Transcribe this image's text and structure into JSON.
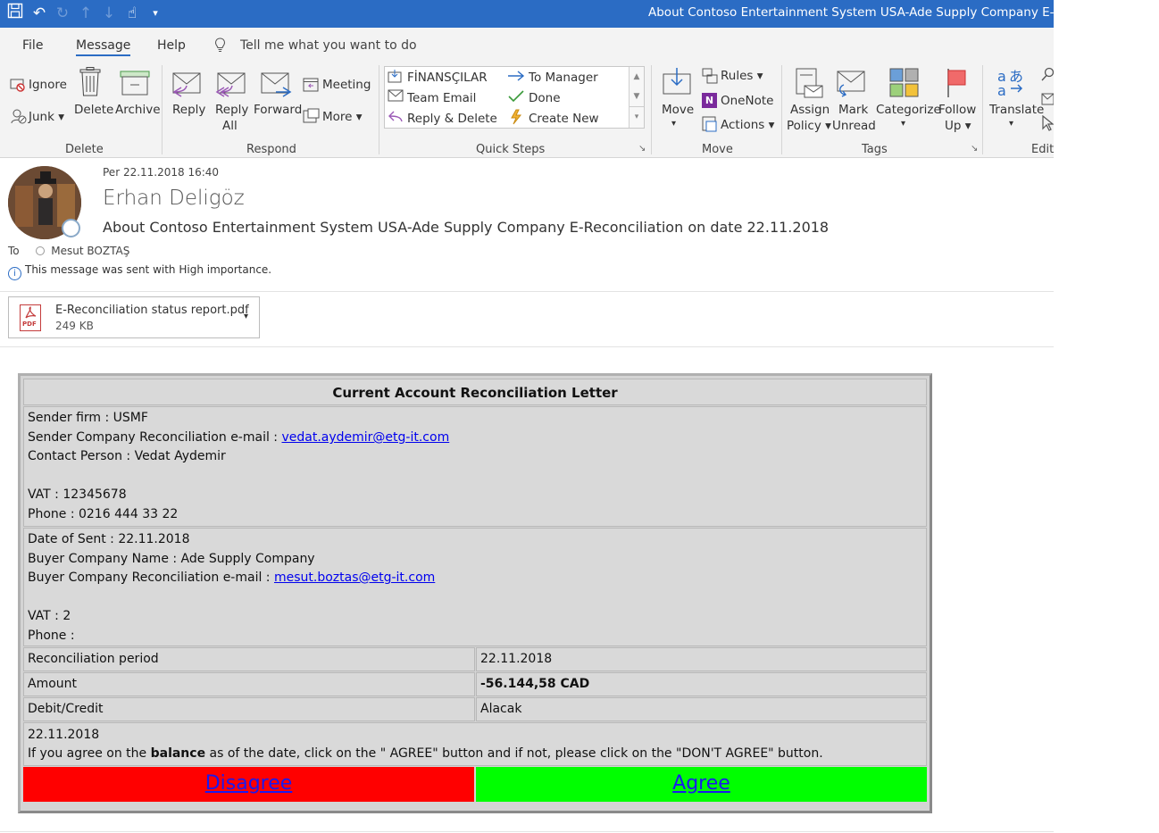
{
  "titlebar": {
    "title": "About Contoso Entertainment System USA-Ade Supply Company E-Reconci"
  },
  "menu": {
    "file": "File",
    "message": "Message",
    "help": "Help",
    "tell_me": "Tell me what you want to do"
  },
  "ribbon": {
    "delete_group": {
      "ignore": "Ignore",
      "junk": "Junk",
      "delete": "Delete",
      "archive": "Archive",
      "label": "Delete"
    },
    "respond_group": {
      "reply": "Reply",
      "reply_all_1": "Reply",
      "reply_all_2": "All",
      "forward": "Forward",
      "meeting": "Meeting",
      "more": "More",
      "label": "Respond"
    },
    "quick_steps": {
      "items": [
        "FİNANSÇILAR",
        "Team Email",
        "Reply & Delete",
        "To Manager",
        "Done",
        "Create New"
      ],
      "label": "Quick Steps"
    },
    "move_group": {
      "move": "Move",
      "rules": "Rules",
      "onenote": "OneNote",
      "actions": "Actions",
      "label": "Move"
    },
    "tags_group": {
      "assign_1": "Assign",
      "assign_2": "Policy",
      "mark_1": "Mark",
      "mark_2": "Unread",
      "categorize": "Categorize",
      "follow_1": "Follow",
      "follow_2": "Up",
      "label": "Tags"
    },
    "edit_group": {
      "translate": "Translate",
      "label": "Edit"
    }
  },
  "header": {
    "date": "Per 22.11.2018 16:40",
    "sender": "Erhan Deligöz",
    "subject": "About Contoso Entertainment System USA-Ade Supply Company E-Reconciliation on date 22.11.2018",
    "to_label": "To",
    "to_name": "Mesut BOZTAŞ",
    "importance": "This message was sent with High importance."
  },
  "attachment": {
    "name": "E-Reconciliation status report.pdf",
    "size": "249 KB",
    "icon_text": "PDF"
  },
  "letter": {
    "title": "Current Account Reconciliation Letter",
    "sender_firm": "Sender firm : USMF",
    "sender_email_label": "Sender Company Reconciliation e-mail : ",
    "sender_email": "vedat.aydemir@etg-it.com",
    "contact": "Contact Person : Vedat Aydemir",
    "sender_vat": "VAT : 12345678",
    "sender_phone": "Phone : 0216 444 33 22",
    "date_sent": "Date of Sent : 22.11.2018",
    "buyer_name": "Buyer Company Name : Ade Supply Company",
    "buyer_email_label": "Buyer Company Reconciliation e-mail : ",
    "buyer_email": "mesut.boztas@etg-it.com",
    "buyer_vat": "VAT : 2",
    "buyer_phone": "Phone :",
    "rows": [
      {
        "label": "Reconciliation period",
        "value": "22.11.2018"
      },
      {
        "label": "Amount",
        "value": "-56.144,58 CAD"
      },
      {
        "label": "Debit/Credit",
        "value": "Alacak"
      }
    ],
    "note_date": "22.11.2018",
    "note_1": "If you agree on the ",
    "note_bold": "balance",
    "note_2": " as of the date, click on the \" AGREE\" button and if not, please click on the \"DON'T AGREE\" button.",
    "disagree": "Disagree",
    "agree": "Agree",
    "disagree_color": "#ff0000",
    "agree_color": "#00ff00"
  }
}
